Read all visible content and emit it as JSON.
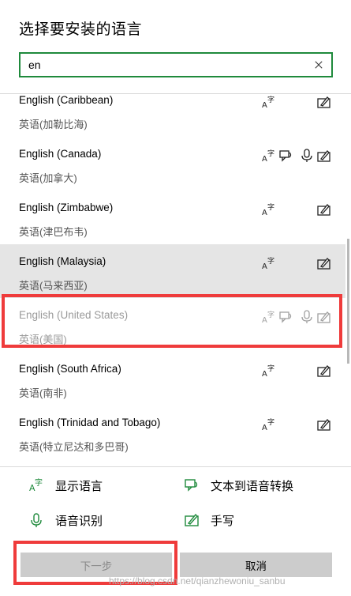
{
  "dialog": {
    "title": "选择要安装的语言"
  },
  "search": {
    "value": "en",
    "clear_icon": "close-icon"
  },
  "languages": [
    {
      "name": "English (Caribbean)",
      "native": "英语(加勒比海)",
      "features": [
        "display-language-icon",
        "handwriting-icon"
      ],
      "selected": false,
      "dim": false
    },
    {
      "name": "English (Canada)",
      "native": "英语(加拿大)",
      "features": [
        "display-language-icon",
        "text-to-speech-icon",
        "speech-recognition-icon",
        "handwriting-icon"
      ],
      "selected": false,
      "dim": false
    },
    {
      "name": "English (Zimbabwe)",
      "native": "英语(津巴布韦)",
      "features": [
        "display-language-icon",
        "handwriting-icon"
      ],
      "selected": false,
      "dim": false
    },
    {
      "name": "English (Malaysia)",
      "native": "英语(马来西亚)",
      "features": [
        "display-language-icon",
        "handwriting-icon"
      ],
      "selected": true,
      "dim": false
    },
    {
      "name": "English (United States)",
      "native": "英语(美国)",
      "features": [
        "display-language-icon",
        "text-to-speech-icon",
        "speech-recognition-icon",
        "handwriting-icon"
      ],
      "selected": false,
      "dim": true
    },
    {
      "name": "English (South Africa)",
      "native": "英语(南非)",
      "features": [
        "display-language-icon",
        "handwriting-icon"
      ],
      "selected": false,
      "dim": false
    },
    {
      "name": "English (Trinidad and Tobago)",
      "native": "英语(特立尼达和多巴哥)",
      "features": [
        "display-language-icon",
        "handwriting-icon"
      ],
      "selected": false,
      "dim": false
    }
  ],
  "legend": {
    "display_language": "显示语言",
    "text_to_speech": "文本到语音转换",
    "speech_recognition": "语音识别",
    "handwriting": "手写"
  },
  "buttons": {
    "next": "下一步",
    "cancel": "取消"
  },
  "watermark": "https://blog.csdn.net/qianzhewoniu_sanbu",
  "colors": {
    "accent_green": "#1f8a3c",
    "annotation_red": "#ef3b3b",
    "selected_row": "#e5e5e5",
    "button_gray": "#cccccc"
  }
}
